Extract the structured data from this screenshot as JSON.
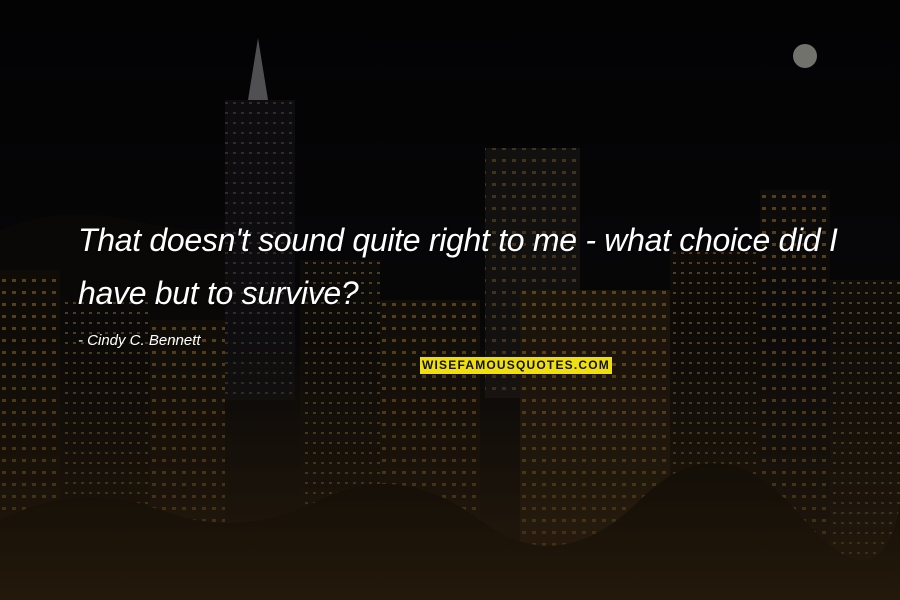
{
  "quote": {
    "text": "That doesn't sound quite right to me - what choice did I have but to survive?",
    "author": "- Cindy C. Bennett"
  },
  "watermark": {
    "text": "WISEFAMOUSQUOTES.COM"
  },
  "background": {
    "description_icon": "night-city-skyline-image",
    "overlay_color": "#07060a",
    "light_color": "#d9a34a"
  }
}
